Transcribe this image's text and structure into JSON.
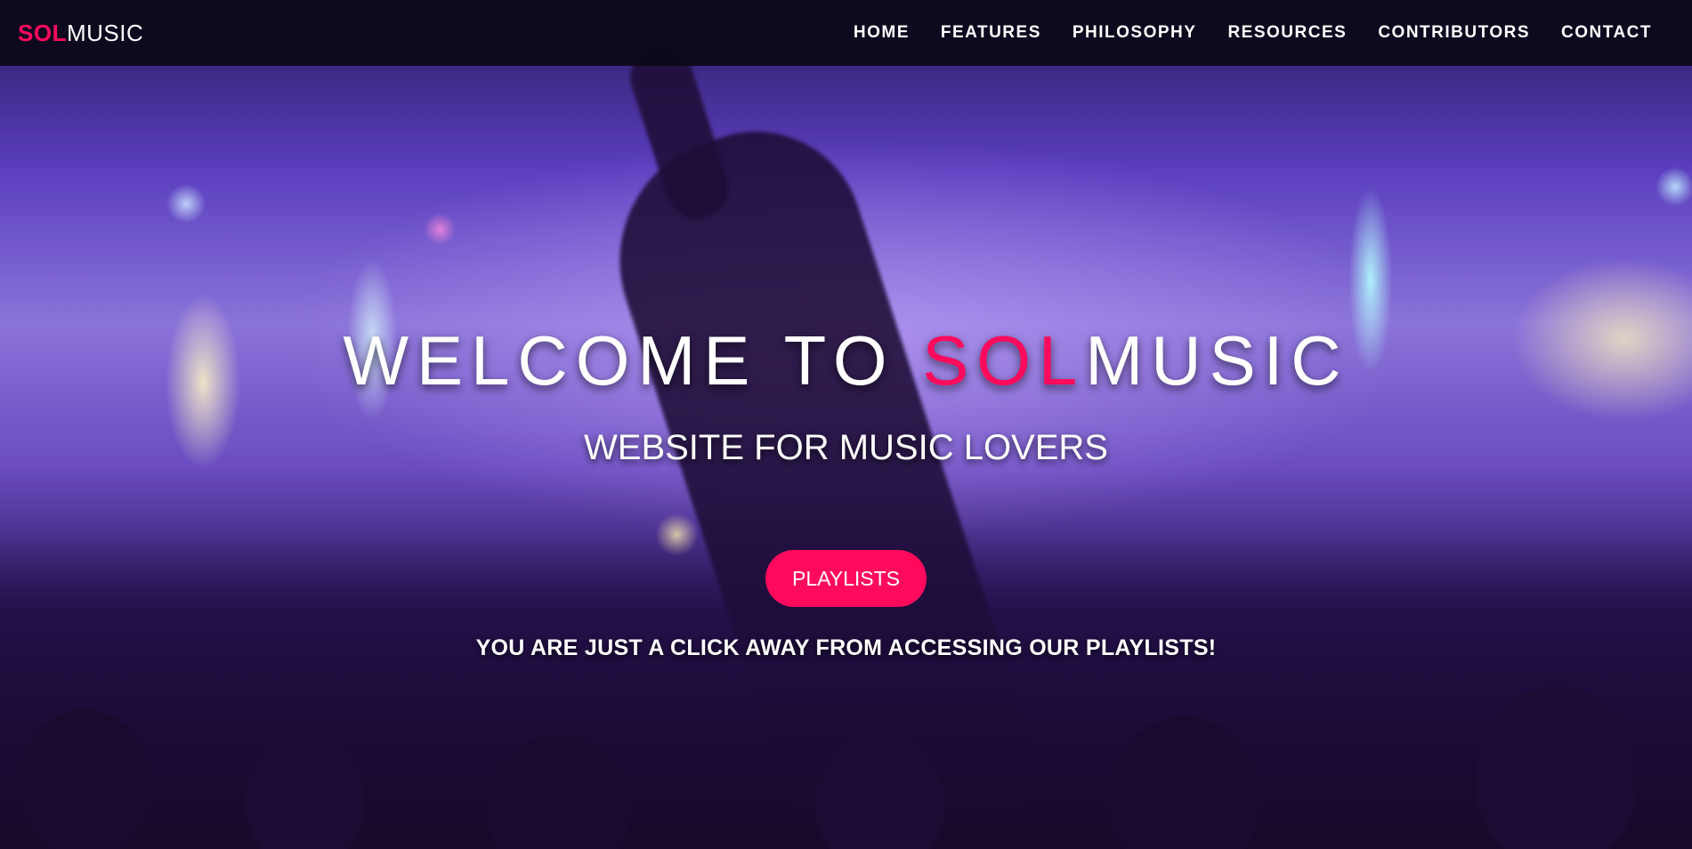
{
  "header": {
    "logo": {
      "part1": "SOL",
      "part2": "MUSIC"
    },
    "nav": [
      {
        "label": "HOME"
      },
      {
        "label": "FEATURES"
      },
      {
        "label": "PHILOSOPHY"
      },
      {
        "label": "RESOURCES"
      },
      {
        "label": "CONTRIBUTORS"
      },
      {
        "label": "CONTACT"
      }
    ]
  },
  "hero": {
    "title_prefix": "WELCOME TO ",
    "title_accent": "SOL",
    "title_suffix": "MUSIC",
    "subtitle": "WEBSITE FOR MUSIC LOVERS",
    "button_label": "PLAYLISTS",
    "tagline": "YOU ARE JUST A CLICK AWAY FROM ACCESSING OUR PLAYLISTS!"
  },
  "colors": {
    "accent": "#ff0a5c",
    "nav_bg": "#0c0818",
    "text": "#ffffff"
  }
}
